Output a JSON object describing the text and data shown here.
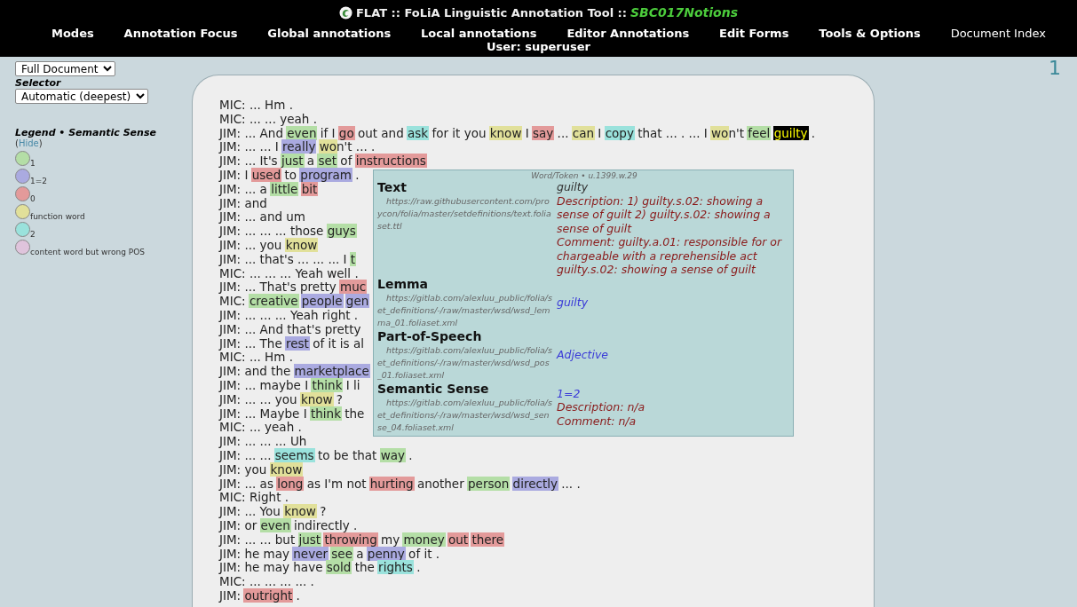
{
  "header": {
    "title": "FLAT :: FoLiA Linguistic Annotation Tool ::",
    "document": "SBC017Notions",
    "user": "User: superuser",
    "menu": [
      {
        "label": "Modes",
        "kind": "menu"
      },
      {
        "label": "Annotation Focus",
        "kind": "menu"
      },
      {
        "label": "Global annotations",
        "kind": "menu"
      },
      {
        "label": "Local annotations",
        "kind": "menu"
      },
      {
        "label": "Editor Annotations",
        "kind": "menu"
      },
      {
        "label": "Edit Forms",
        "kind": "menu"
      },
      {
        "label": "Tools & Options",
        "kind": "menu"
      },
      {
        "label": "Document Index",
        "kind": "link"
      }
    ]
  },
  "sidebar": {
    "perspective": {
      "value": "Full Document"
    },
    "selector": {
      "label": "Selector",
      "value": "Automatic (deepest)"
    },
    "legend": {
      "title": "Legend • Semantic Sense",
      "hide_open": "(",
      "hide_link": "Hide",
      "hide_close": ")",
      "items": [
        {
          "label": "1",
          "color": "#b4dea6"
        },
        {
          "label": "1=2",
          "color": "#aaaae0"
        },
        {
          "label": "0",
          "color": "#e39a9a"
        },
        {
          "label": "function word",
          "color": "#e1e09a"
        },
        {
          "label": "2",
          "color": "#9ae2dc"
        },
        {
          "label": "content word but wrong POS",
          "color": "#dfc4dc"
        }
      ]
    }
  },
  "page_number": "1",
  "document": {
    "lines": [
      {
        "parts": [
          {
            "text": "MIC: ... Hm ."
          }
        ]
      },
      {
        "parts": [
          {
            "text": "MIC: ... ... yeah ."
          }
        ]
      },
      {
        "parts": [
          {
            "text": "JIM: ... And "
          },
          {
            "text": "even",
            "color": "#b4dea6",
            "selected": false
          },
          {
            "text": " if I "
          },
          {
            "text": "go",
            "color": "#e39a9a",
            "selected": false
          },
          {
            "text": " out and "
          },
          {
            "text": "ask",
            "color": "#9ae2dc",
            "selected": false
          },
          {
            "text": " for it you "
          },
          {
            "text": "know",
            "color": "#e1e09a",
            "selected": false
          },
          {
            "text": " I "
          },
          {
            "text": "say",
            "color": "#e39a9a",
            "selected": false
          },
          {
            "text": " ... "
          },
          {
            "text": "can",
            "color": "#e1e09a",
            "selected": false
          },
          {
            "text": " I "
          },
          {
            "text": "copy",
            "color": "#9ae2dc",
            "selected": false
          },
          {
            "text": " that ... . ... I "
          },
          {
            "text": "wo",
            "color": "#e1e09a",
            "selected": false
          },
          {
            "text": "n't "
          },
          {
            "text": "feel",
            "color": "#b4dea6",
            "selected": false
          },
          {
            "text": "guilty",
            "selected": true
          },
          {
            "text": " ."
          }
        ]
      },
      {
        "parts": [
          {
            "text": "JIM: ... ... I "
          },
          {
            "text": "really",
            "color": "#aaaae0",
            "selected": false
          },
          {
            "text": "wo",
            "color": "#e1e09a",
            "selected": false
          },
          {
            "text": "n't ... ."
          }
        ]
      },
      {
        "parts": [
          {
            "text": "JIM: ... It's "
          },
          {
            "text": "just",
            "color": "#b4dea6",
            "selected": false
          },
          {
            "text": " a "
          },
          {
            "text": "set",
            "color": "#b4dea6",
            "selected": false
          },
          {
            "text": " of "
          },
          {
            "text": "instructions",
            "color": "#e39a9a",
            "selected": false
          }
        ]
      },
      {
        "parts": [
          {
            "text": "JIM: I "
          },
          {
            "text": "used",
            "color": "#e39a9a",
            "selected": false
          },
          {
            "text": " to "
          },
          {
            "text": "program",
            "color": "#aaaae0",
            "selected": false
          },
          {
            "text": " ."
          }
        ]
      },
      {
        "parts": [
          {
            "text": "JIM: ... a "
          },
          {
            "text": "little",
            "color": "#b4dea6",
            "selected": false
          },
          {
            "text": "bit",
            "color": "#e39a9a",
            "selected": false
          }
        ]
      },
      {
        "parts": [
          {
            "text": "JIM: and"
          }
        ]
      },
      {
        "parts": [
          {
            "text": "JIM: ... and um"
          }
        ]
      },
      {
        "parts": [
          {
            "text": "JIM: ... ... ... those "
          },
          {
            "text": "guys",
            "color": "#b4dea6",
            "selected": false
          }
        ]
      },
      {
        "parts": [
          {
            "text": "JIM: ... you "
          },
          {
            "text": "know",
            "color": "#e1e09a",
            "selected": false
          }
        ]
      },
      {
        "parts": [
          {
            "text": "JIM: ... that's ... ... ... I "
          },
          {
            "text": "t",
            "color": "#b4dea6",
            "selected": false
          }
        ]
      },
      {
        "parts": [
          {
            "text": "MIC: ... ... ... Yeah well ."
          }
        ]
      },
      {
        "parts": [
          {
            "text": "JIM: ... That's pretty "
          },
          {
            "text": "muc",
            "color": "#e39a9a",
            "selected": false
          }
        ]
      },
      {
        "parts": [
          {
            "text": "MIC: "
          },
          {
            "text": "creative",
            "color": "#b4dea6",
            "selected": false
          },
          {
            "text": "people",
            "color": "#aaaae0",
            "selected": false
          },
          {
            "text": "gen",
            "color": "#aaaae0",
            "selected": false
          }
        ]
      },
      {
        "parts": [
          {
            "text": "JIM: ... ... ... Yeah right ."
          }
        ]
      },
      {
        "parts": [
          {
            "text": "JIM: ... And that's pretty"
          }
        ]
      },
      {
        "parts": [
          {
            "text": "JIM: ... The "
          },
          {
            "text": "rest",
            "color": "#aaaae0",
            "selected": false
          },
          {
            "text": " of it is al"
          }
        ]
      },
      {
        "parts": [
          {
            "text": "MIC: ... Hm ."
          }
        ]
      },
      {
        "parts": [
          {
            "text": "JIM: and the "
          },
          {
            "text": "marketplace",
            "color": "#aaaae0",
            "selected": false
          }
        ]
      },
      {
        "parts": [
          {
            "text": "JIM: ... maybe I "
          },
          {
            "text": "think",
            "color": "#b4dea6",
            "selected": false
          },
          {
            "text": " I li"
          }
        ]
      },
      {
        "parts": [
          {
            "text": "JIM: ... ... you "
          },
          {
            "text": "know",
            "color": "#e1e09a",
            "selected": false
          },
          {
            "text": " ?"
          }
        ]
      },
      {
        "parts": [
          {
            "text": "JIM: ... Maybe I "
          },
          {
            "text": "think",
            "color": "#b4dea6",
            "selected": false
          },
          {
            "text": " the"
          }
        ]
      },
      {
        "parts": [
          {
            "text": "MIC: ... yeah ."
          }
        ]
      },
      {
        "parts": [
          {
            "text": "JIM: ... ... ... Uh"
          }
        ]
      },
      {
        "parts": [
          {
            "text": "JIM: ... ... "
          },
          {
            "text": "seems",
            "color": "#9ae2dc",
            "selected": false
          },
          {
            "text": " to be that "
          },
          {
            "text": "way",
            "color": "#b4dea6",
            "selected": false
          },
          {
            "text": " ."
          }
        ]
      },
      {
        "parts": [
          {
            "text": "JIM: you "
          },
          {
            "text": "know",
            "color": "#e1e09a",
            "selected": false
          }
        ]
      },
      {
        "parts": [
          {
            "text": "JIM: ... as "
          },
          {
            "text": "long",
            "color": "#e39a9a",
            "selected": false
          },
          {
            "text": " as I'm not "
          },
          {
            "text": "hurting",
            "color": "#e39a9a",
            "selected": false
          },
          {
            "text": " another "
          },
          {
            "text": "person",
            "color": "#b4dea6",
            "selected": false
          },
          {
            "text": "directly",
            "color": "#aaaae0",
            "selected": false
          },
          {
            "text": " ... ."
          }
        ]
      },
      {
        "parts": [
          {
            "text": "MIC: Right ."
          }
        ]
      },
      {
        "parts": [
          {
            "text": "JIM: ... You "
          },
          {
            "text": "know",
            "color": "#e1e09a",
            "selected": false
          },
          {
            "text": " ?"
          }
        ]
      },
      {
        "parts": [
          {
            "text": "JIM: or "
          },
          {
            "text": "even",
            "color": "#b4dea6",
            "selected": false
          },
          {
            "text": " indirectly ."
          }
        ]
      },
      {
        "parts": [
          {
            "text": "JIM: ... ... but "
          },
          {
            "text": "just",
            "color": "#b4dea6",
            "selected": false
          },
          {
            "text": "throwing",
            "color": "#e39a9a",
            "selected": false
          },
          {
            "text": " my "
          },
          {
            "text": "money",
            "color": "#b4dea6",
            "selected": false
          },
          {
            "text": "out",
            "color": "#e39a9a",
            "selected": false
          },
          {
            "text": "there",
            "color": "#e39a9a",
            "selected": false
          }
        ]
      },
      {
        "parts": [
          {
            "text": "JIM: he may "
          },
          {
            "text": "never",
            "color": "#aaaae0",
            "selected": false
          },
          {
            "text": "see",
            "color": "#b4dea6",
            "selected": false
          },
          {
            "text": " a "
          },
          {
            "text": "penny",
            "color": "#aaaae0",
            "selected": false
          },
          {
            "text": " of it ."
          }
        ]
      },
      {
        "parts": [
          {
            "text": "JIM: he may have "
          },
          {
            "text": "sold",
            "color": "#b4dea6",
            "selected": false
          },
          {
            "text": " the "
          },
          {
            "text": "rights",
            "color": "#9ae2dc",
            "selected": false
          },
          {
            "text": " ."
          }
        ]
      },
      {
        "parts": [
          {
            "text": "MIC: ... ... ... ... ."
          }
        ]
      },
      {
        "parts": [
          {
            "text": "JIM: "
          },
          {
            "text": "outright",
            "color": "#e39a9a",
            "selected": false
          },
          {
            "text": " ."
          }
        ]
      }
    ]
  },
  "tooltip": {
    "header": "Word/Token • u.1399.w.29",
    "sections": [
      {
        "title": "Text",
        "set": "https://raw.githubusercontent.com/proycon/folia/master/setdefinitions/text.foliaset.ttl",
        "values": [
          {
            "kind": "text",
            "text": "guilty"
          },
          {
            "kind": "note",
            "text": "Description: 1) guilty.s.02: showing a sense of guilt 2) guilty.s.02: showing a sense of guilt"
          },
          {
            "kind": "note",
            "text": "Comment: guilty.a.01: responsible for or chargeable with a reprehensible act guilty.s.02: showing a sense of guilt"
          }
        ]
      },
      {
        "title": "Lemma",
        "set": "https://gitlab.com/alexluu_public/folia/set_definitions/-/raw/master/wsd/wsd_lemma_01.foliaset.xml",
        "values": [
          {
            "kind": "class",
            "text": "guilty"
          }
        ]
      },
      {
        "title": "Part-of-Speech",
        "set": "https://gitlab.com/alexluu_public/folia/set_definitions/-/raw/master/wsd/wsd_pos_01.foliaset.xml",
        "values": [
          {
            "kind": "class",
            "text": "Adjective"
          }
        ]
      },
      {
        "title": "Semantic Sense",
        "set": "https://gitlab.com/alexluu_public/folia/set_definitions/-/raw/master/wsd/wsd_sense_04.foliaset.xml",
        "values": [
          {
            "kind": "class",
            "text": "1=2"
          },
          {
            "kind": "note",
            "text": "Description: n/a"
          },
          {
            "kind": "note",
            "text": "Comment: n/a"
          }
        ]
      }
    ]
  }
}
